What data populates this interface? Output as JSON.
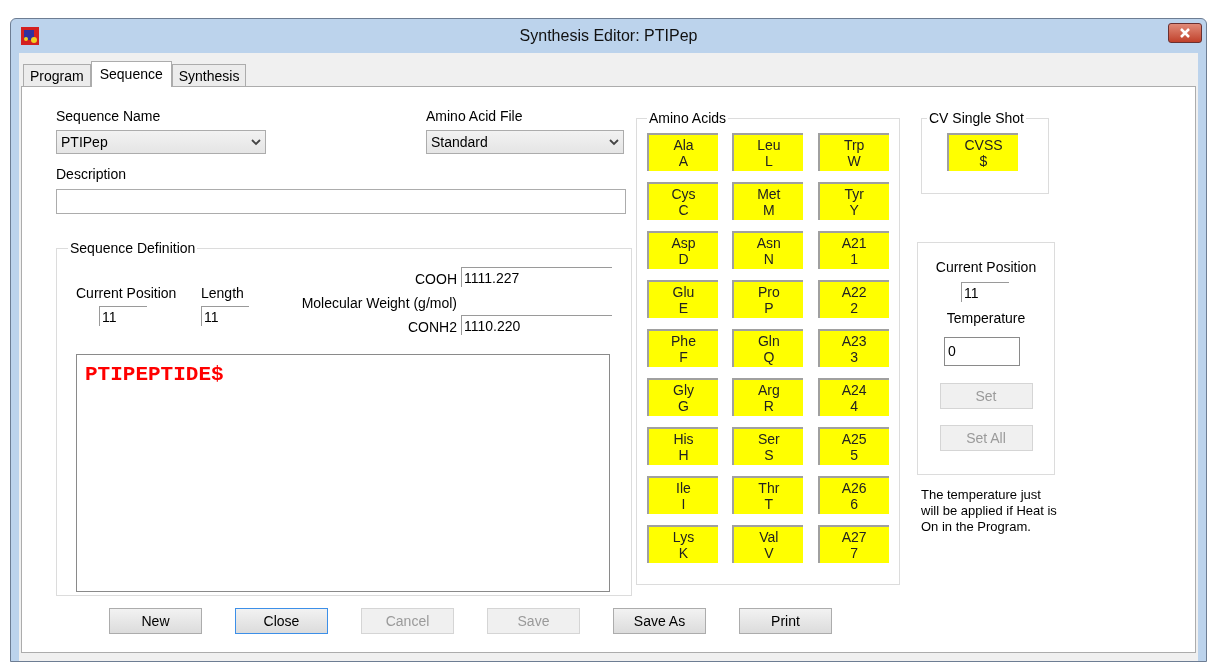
{
  "window": {
    "title": "Synthesis Editor: PTIPep"
  },
  "tabs": [
    {
      "label": "Program",
      "selected": false
    },
    {
      "label": "Sequence",
      "selected": true
    },
    {
      "label": "Synthesis",
      "selected": false
    }
  ],
  "sequence_name": {
    "label": "Sequence Name",
    "value": "PTIPep"
  },
  "amino_acid_file": {
    "label": "Amino Acid File",
    "value": "Standard"
  },
  "description": {
    "label": "Description"
  },
  "sequence_definition": {
    "title": "Sequence Definition",
    "current_position": {
      "label": "Current Position",
      "value": "11"
    },
    "length": {
      "label": "Length",
      "value": "11"
    },
    "molecular_weight_label": "Molecular Weight (g/mol)",
    "cooh": {
      "label": "COOH",
      "value": "1111.227"
    },
    "conh2": {
      "label": "CONH2",
      "value": "1110.220"
    },
    "sequence": "PTIPEPTIDE$"
  },
  "amino_acids": {
    "title": "Amino Acids",
    "items": [
      {
        "name": "Ala",
        "code": "A"
      },
      {
        "name": "Leu",
        "code": "L"
      },
      {
        "name": "Trp",
        "code": "W"
      },
      {
        "name": "Cys",
        "code": "C"
      },
      {
        "name": "Met",
        "code": "M"
      },
      {
        "name": "Tyr",
        "code": "Y"
      },
      {
        "name": "Asp",
        "code": "D"
      },
      {
        "name": "Asn",
        "code": "N"
      },
      {
        "name": "A21",
        "code": "1"
      },
      {
        "name": "Glu",
        "code": "E"
      },
      {
        "name": "Pro",
        "code": "P"
      },
      {
        "name": "A22",
        "code": "2"
      },
      {
        "name": "Phe",
        "code": "F"
      },
      {
        "name": "Gln",
        "code": "Q"
      },
      {
        "name": "A23",
        "code": "3"
      },
      {
        "name": "Gly",
        "code": "G"
      },
      {
        "name": "Arg",
        "code": "R"
      },
      {
        "name": "A24",
        "code": "4"
      },
      {
        "name": "His",
        "code": "H"
      },
      {
        "name": "Ser",
        "code": "S"
      },
      {
        "name": "A25",
        "code": "5"
      },
      {
        "name": "Ile",
        "code": "I"
      },
      {
        "name": "Thr",
        "code": "T"
      },
      {
        "name": "A26",
        "code": "6"
      },
      {
        "name": "Lys",
        "code": "K"
      },
      {
        "name": "Val",
        "code": "V"
      },
      {
        "name": "A27",
        "code": "7"
      }
    ]
  },
  "cv_single_shot": {
    "title": "CV Single Shot",
    "name": "CVSS",
    "code": "$"
  },
  "temperature_panel": {
    "current_position": {
      "label": "Current Position",
      "value": "11"
    },
    "temperature": {
      "label": "Temperature",
      "value": "0"
    },
    "buttons": [
      {
        "label": "Set",
        "disabled": true
      },
      {
        "label": "Set All",
        "disabled": true
      }
    ]
  },
  "note": "The temperature just will be applied if Heat is On in the Program.",
  "buttons": [
    {
      "label": "New",
      "disabled": false,
      "focused": false
    },
    {
      "label": "Close",
      "disabled": false,
      "focused": true
    },
    {
      "label": "Cancel",
      "disabled": true,
      "focused": false
    },
    {
      "label": "Save",
      "disabled": true,
      "focused": false
    },
    {
      "label": "Save As",
      "disabled": false,
      "focused": false
    },
    {
      "label": "Print",
      "disabled": false,
      "focused": false
    }
  ]
}
